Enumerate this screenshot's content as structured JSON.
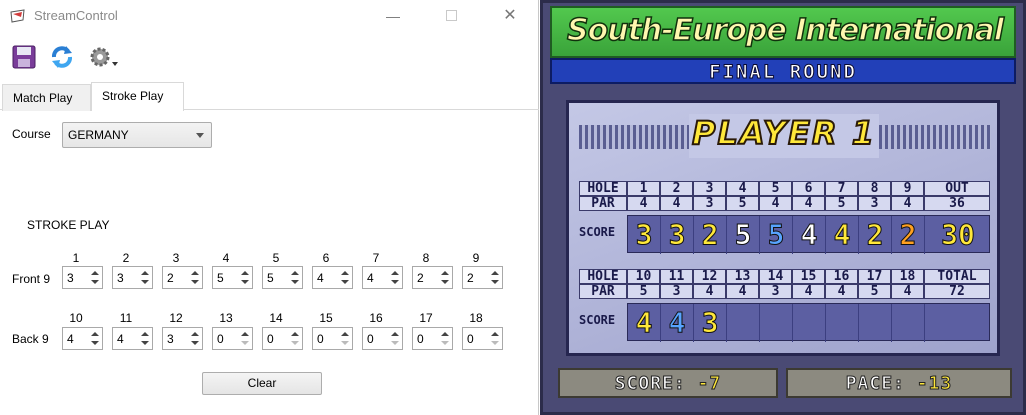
{
  "window": {
    "title": "StreamControl"
  },
  "tabs": [
    {
      "label": "Match Play"
    },
    {
      "label": "Stroke Play"
    }
  ],
  "course": {
    "label": "Course",
    "value": "GERMANY"
  },
  "stroke": {
    "heading": "STROKE PLAY",
    "front_label": "Front 9",
    "back_label": "Back 9",
    "front_holes": [
      "1",
      "2",
      "3",
      "4",
      "5",
      "6",
      "7",
      "8",
      "9"
    ],
    "back_holes": [
      "10",
      "11",
      "12",
      "13",
      "14",
      "15",
      "16",
      "17",
      "18"
    ],
    "front_values": [
      "3",
      "3",
      "2",
      "5",
      "5",
      "4",
      "4",
      "2",
      "2"
    ],
    "back_values": [
      "4",
      "4",
      "3",
      "0",
      "0",
      "0",
      "0",
      "0",
      "0"
    ]
  },
  "clear_label": "Clear",
  "game": {
    "title": "South-Europe International",
    "round": "FINAL ROUND",
    "player": "PLAYER  1",
    "hole_label": "HOLE",
    "par_label": "PAR",
    "score_label": "SCORE",
    "out_label": "OUT",
    "total_label": "TOTAL",
    "front_holes": [
      "1",
      "2",
      "3",
      "4",
      "5",
      "6",
      "7",
      "8",
      "9"
    ],
    "front_par": [
      "4",
      "4",
      "3",
      "5",
      "4",
      "4",
      "5",
      "3",
      "4"
    ],
    "out_par": "36",
    "front_scores": [
      "3",
      "3",
      "2",
      "5",
      "5",
      "4",
      "4",
      "2",
      "2"
    ],
    "front_score_colors": [
      "#ffe83a",
      "#ffe83a",
      "#ffe83a",
      "#ffffff",
      "#58a4ff",
      "#ffffff",
      "#ffe83a",
      "#ffe83a",
      "#ffa020"
    ],
    "out_score": "30",
    "back_holes": [
      "10",
      "11",
      "12",
      "13",
      "14",
      "15",
      "16",
      "17",
      "18"
    ],
    "back_par": [
      "5",
      "3",
      "4",
      "4",
      "3",
      "4",
      "4",
      "5",
      "4"
    ],
    "total_par": "72",
    "back_scores": [
      "4",
      "4",
      "3"
    ],
    "back_score_colors": [
      "#ffe83a",
      "#58a4ff",
      "#ffe83a"
    ],
    "score_text": "SCORE:",
    "score_value": "-7",
    "pace_text": "PACE:",
    "pace_value": "-13"
  },
  "icons": [
    "app-icon",
    "save-icon",
    "refresh-icon",
    "gear-icon",
    "minimize-icon",
    "maximize-icon",
    "close-icon"
  ]
}
